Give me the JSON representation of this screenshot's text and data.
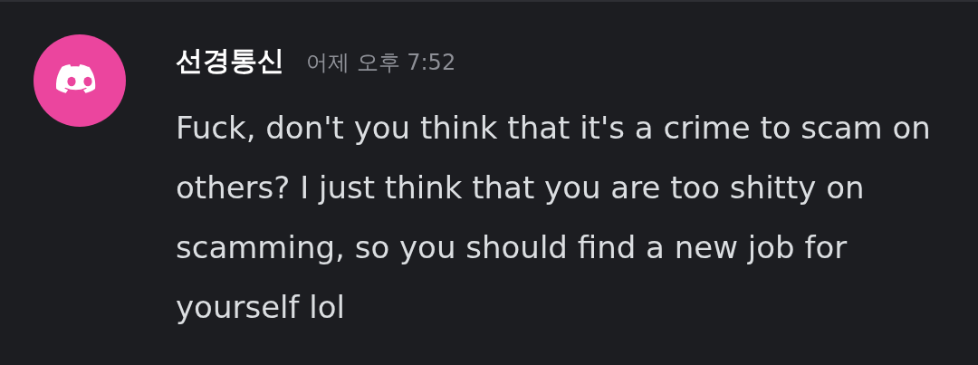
{
  "message": {
    "author": "선경통신",
    "timestamp": "어제 오후 7:52",
    "text": "Fuck, don't you think that it's a crime to scam on others? I just think that you are too shitty on scamming, so you should find a new job for yourself lol"
  }
}
